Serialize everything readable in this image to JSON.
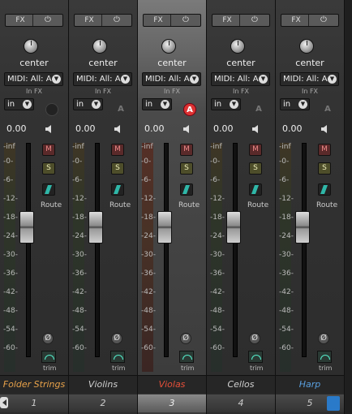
{
  "mixer": {
    "strips": [
      {
        "name": "Folder Strings",
        "name_color": "#e8a24a",
        "number": "1",
        "fx": "FX",
        "pan": "center",
        "midi": "MIDI: All: A",
        "in_fx": "In FX",
        "input": "in",
        "arm": "",
        "arm_style": "round",
        "volume": "0.00",
        "mute": "M",
        "solo": "S",
        "route": "Route",
        "trim": "trim",
        "phase": "Ø",
        "fader_level": 0.62,
        "meter_style": "default",
        "selected": false
      },
      {
        "name": "Violins",
        "name_color": "#d0d0d0",
        "number": "2",
        "fx": "FX",
        "pan": "center",
        "midi": "MIDI: All: A",
        "in_fx": "In FX",
        "input": "in",
        "arm": "A",
        "arm_style": "plain",
        "volume": "0.00",
        "mute": "M",
        "solo": "S",
        "route": "Route",
        "trim": "trim",
        "phase": "Ø",
        "fader_level": 0.62,
        "meter_style": "default",
        "selected": false
      },
      {
        "name": "Violas",
        "name_color": "#e8503a",
        "number": "3",
        "fx": "FX",
        "pan": "center",
        "midi": "MIDI: All: A",
        "in_fx": "In FX",
        "input": "in",
        "arm": "A",
        "arm_style": "on",
        "volume": "0.00",
        "mute": "M",
        "solo": "S",
        "route": "Route",
        "trim": "trim",
        "phase": "Ø",
        "fader_level": 0.62,
        "meter_style": "red",
        "selected": true
      },
      {
        "name": "Cellos",
        "name_color": "#d0d0d0",
        "number": "4",
        "fx": "FX",
        "pan": "center",
        "midi": "MIDI: All: A",
        "in_fx": "In FX",
        "input": "in",
        "arm": "A",
        "arm_style": "plain",
        "volume": "0.00",
        "mute": "M",
        "solo": "S",
        "route": "Route",
        "trim": "trim",
        "phase": "Ø",
        "fader_level": 0.62,
        "meter_style": "default",
        "selected": false
      },
      {
        "name": "Harp",
        "name_color": "#5aa0e0",
        "number": "5",
        "fx": "FX",
        "pan": "center",
        "midi": "MIDI: All: A",
        "in_fx": "In FX",
        "input": "in",
        "arm": "A",
        "arm_style": "plain",
        "volume": "0.00",
        "mute": "M",
        "solo": "S",
        "route": "Route",
        "trim": "trim",
        "phase": "Ø",
        "fader_level": 0.62,
        "meter_style": "default",
        "selected": false
      }
    ],
    "meter_scale": [
      "-inf",
      "-0-",
      "-6-",
      "-12-",
      "-18-",
      "-24-",
      "-30-",
      "-36-",
      "-42-",
      "-48-",
      "-54-",
      "-60-"
    ]
  },
  "icons": {
    "power": "power-icon",
    "speaker": "speaker-icon",
    "dropdown": "dropdown-icon",
    "route": "route-icon",
    "trim": "trim-icon",
    "phase": "phase-icon"
  }
}
